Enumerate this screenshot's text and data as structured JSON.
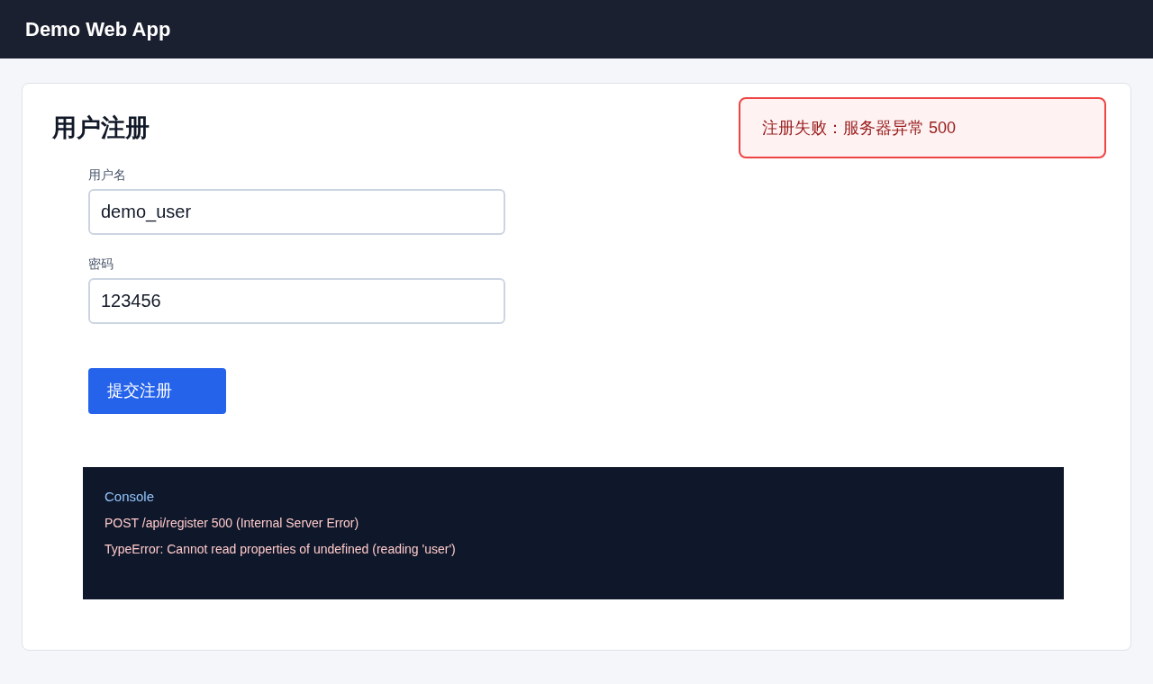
{
  "header": {
    "title": "Demo Web App"
  },
  "form": {
    "title": "用户注册",
    "fields": [
      {
        "label": "用户名",
        "value": "demo_user"
      },
      {
        "label": "密码",
        "value": "123456"
      }
    ],
    "submit_button": "提交注册"
  },
  "alert": {
    "kind": "error",
    "message": "注册失败：服务器异常 500"
  },
  "console": {
    "title": "Console",
    "lines": [
      "POST /api/register 500 (Internal Server Error)",
      "TypeError: Cannot read properties of undefined (reading 'user')"
    ]
  }
}
